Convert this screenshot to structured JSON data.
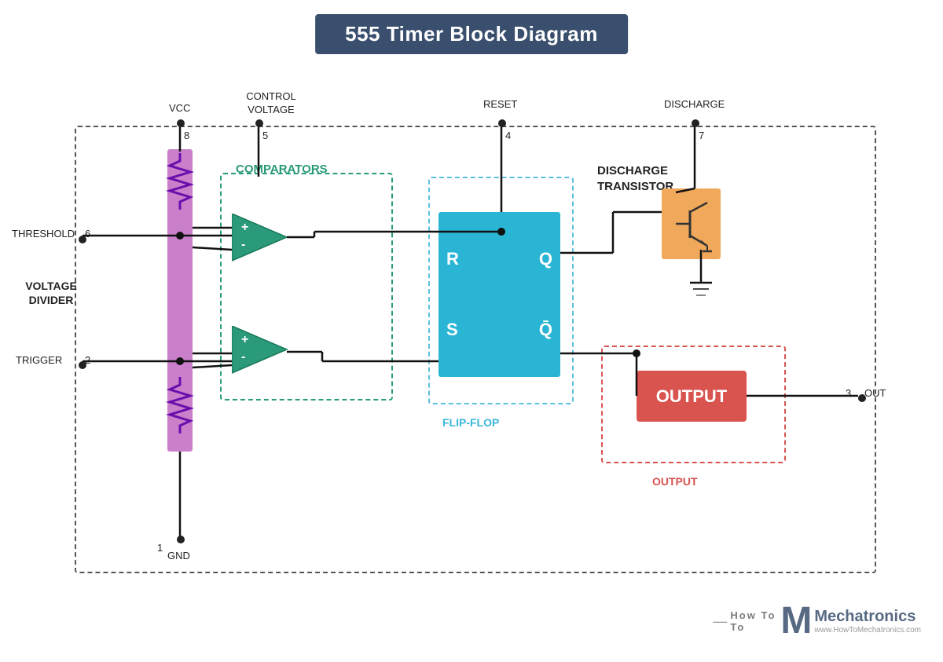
{
  "title": "555 Timer Block Diagram",
  "labels": {
    "vcc": "VCC",
    "control_voltage": "CONTROL\nVOLTAGE",
    "reset": "RESET",
    "discharge": "DISCHARGE",
    "threshold": "THRESHOLD",
    "trigger": "TRIGGER",
    "gnd": "GND",
    "out": "OUT",
    "comparators": "COMPARATORS",
    "flipflop": "FLIP-FLOP",
    "output": "OUTPUT",
    "discharge_transistor": "DISCHARGE\nTRANSISTOR",
    "voltage_divider": "VOLTAGE\nDIVIDER",
    "ff_r": "R",
    "ff_q": "Q",
    "ff_s": "S",
    "ff_qbar": "Q̄",
    "output_label": "OUTPUT",
    "pin1": "1",
    "pin2": "2",
    "pin3": "3",
    "pin4": "4",
    "pin5": "5",
    "pin6": "6",
    "pin7": "7",
    "pin8": "8"
  },
  "colors": {
    "title_bg": "#3a4f6e",
    "comparator_fill": "#2a9a7a",
    "flipflop_fill": "#2ab5d5",
    "output_fill": "#d9534f",
    "transistor_fill": "#f0a85a",
    "voltage_divider_fill": "#c97fc9",
    "wire_color": "#111111",
    "outer_dash": "#555555",
    "comparator_dash": "#2a9a7a",
    "flipflop_dash": "#5bbfdf",
    "output_dash": "#d9534f"
  },
  "watermark": {
    "dash": "—",
    "how": "How To",
    "mec": "Mechatronics",
    "url": "www.HowToMechatronics.com"
  }
}
